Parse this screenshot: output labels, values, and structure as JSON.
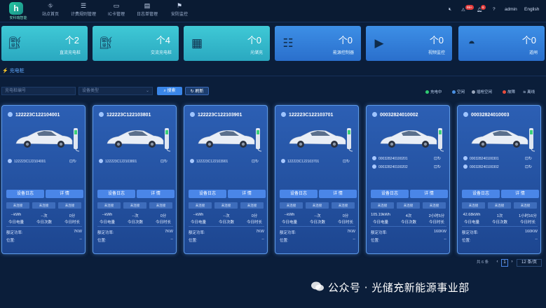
{
  "logo": {
    "text": "安科瑞智能"
  },
  "nav": [
    {
      "label": "站点首页",
      "icon": "sitemap-icon"
    },
    {
      "label": "计费规则管理",
      "icon": "list-icon"
    },
    {
      "label": "IC卡管理",
      "icon": "card-icon"
    },
    {
      "label": "日志单管理",
      "icon": "log-icon"
    },
    {
      "label": "安防监控",
      "icon": "flag-icon"
    }
  ],
  "topright": {
    "alarm_badge": "99+",
    "notify_badge": "6",
    "user": "admin",
    "lang": "English"
  },
  "stats": [
    {
      "count": "个2",
      "label": "直流充电桩",
      "icon": "charger-icon"
    },
    {
      "count": "个4",
      "label": "交流充电桩",
      "icon": "charger-icon"
    },
    {
      "count": "个0",
      "label": "光储充",
      "icon": "solar-panel-icon"
    },
    {
      "count": "个0",
      "label": "能源控制器",
      "icon": "controller-icon"
    },
    {
      "count": "个0",
      "label": "视频监控",
      "icon": "camera-icon"
    },
    {
      "count": "个0",
      "label": "道闸",
      "icon": "gate-icon"
    }
  ],
  "tab": "充电桩",
  "filters": {
    "pile_no_placeholder": "充电桩编号",
    "device_type_placeholder": "设备类型",
    "search": "搜索",
    "refresh": "刷新"
  },
  "legend": [
    {
      "label": "充电中",
      "color": "#2ecc71"
    },
    {
      "label": "空闲",
      "color": "#4a90e2"
    },
    {
      "label": "插枪空闲",
      "color": "#9aa7bb"
    },
    {
      "label": "故障",
      "color": "#e74c3c"
    },
    {
      "label": "离线",
      "color": "#c8d2e0"
    }
  ],
  "common": {
    "log_btn": "设备日志",
    "detail_btn": "详 情",
    "tag": "未连接",
    "m1": "今日电量",
    "m2": "今日次数",
    "m3": "今日时长",
    "power_label": "额定功率:",
    "loc_label": "位置:",
    "loc_value": "--"
  },
  "cards": [
    {
      "id": "122223C122104001",
      "guns": [
        "122223C122104001"
      ],
      "v1": "--kWh",
      "v2": "--次",
      "v3": "0分",
      "power": "7KW"
    },
    {
      "id": "122223C122103801",
      "guns": [
        "122223C122103801"
      ],
      "v1": "--kWh",
      "v2": "--次",
      "v3": "0分",
      "power": "7KW"
    },
    {
      "id": "122223C122103901",
      "guns": [
        "122223C122103901"
      ],
      "v1": "--kWh",
      "v2": "--次",
      "v3": "0分",
      "power": "7KW"
    },
    {
      "id": "122223C122103701",
      "guns": [
        "122223C122103701"
      ],
      "v1": "--kWh",
      "v2": "--次",
      "v3": "0分",
      "power": "7KW"
    },
    {
      "id": "00032824010002",
      "guns": [
        "000328240100201",
        "000328240100202"
      ],
      "v1": "105.19kWh",
      "v2": "4次",
      "v3": "2小时5分",
      "power": "160KW"
    },
    {
      "id": "00032824010003",
      "guns": [
        "000328240100301",
        "000328240100302"
      ],
      "v1": "42.68kWh",
      "v2": "1次",
      "v3": "1小时16分",
      "power": "160KW"
    }
  ],
  "pager": {
    "total": "共 6 条",
    "page": "1",
    "size": "12 条/页"
  },
  "watermark": "公众号 · 光储充新能源事业部"
}
